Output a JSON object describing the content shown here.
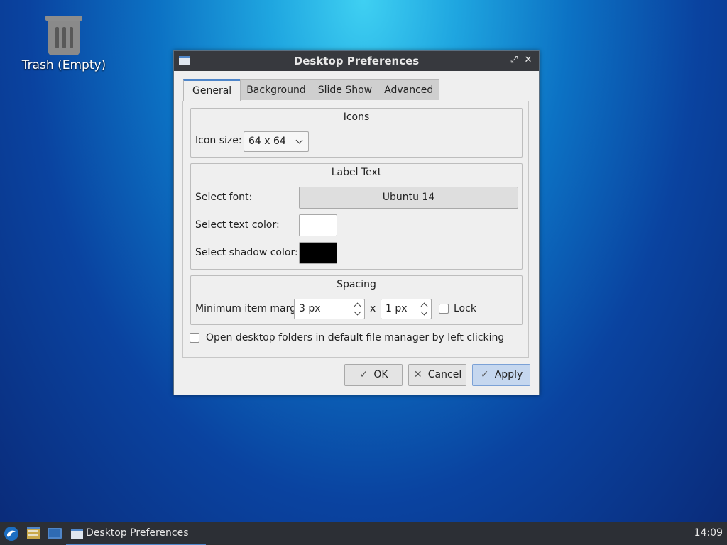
{
  "desktop": {
    "trash_label": "Trash (Empty)"
  },
  "window": {
    "title": "Desktop Preferences",
    "controls": {
      "minimize": "–",
      "maximize": "⤢",
      "close": "✕"
    }
  },
  "tabs": [
    "General",
    "Background",
    "Slide Show",
    "Advanced"
  ],
  "icons_group": {
    "title": "Icons",
    "icon_size_label": "Icon size:",
    "icon_size_value": "64 x 64"
  },
  "label_group": {
    "title": "Label Text",
    "font_label": "Select font:",
    "font_value": "Ubuntu 14",
    "text_color_label": "Select text color:",
    "shadow_color_label": "Select shadow color:",
    "text_color": "#ffffff",
    "shadow_color": "#000000"
  },
  "spacing_group": {
    "title": "Spacing",
    "margins_label": "Minimum item margins:",
    "margin_x": "3 px",
    "separator": "x",
    "margin_y": "1 px",
    "lock_label": "Lock"
  },
  "open_folders_label": "Open desktop folders in default file manager by left clicking",
  "buttons": {
    "ok": "OK",
    "cancel": "Cancel",
    "apply": "Apply"
  },
  "taskbar": {
    "task_title": "Desktop Preferences",
    "clock": "14:09"
  },
  "colors": {
    "accent": "#4f86c9",
    "titlebar": "#37393e",
    "taskbar": "#2c2f35"
  }
}
